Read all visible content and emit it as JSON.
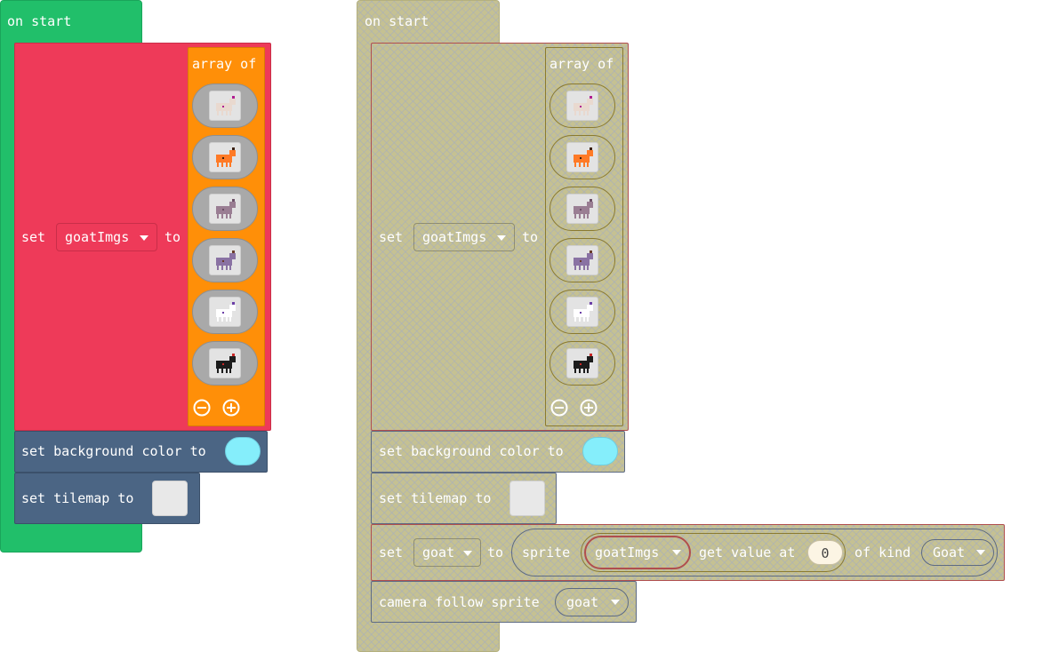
{
  "left_stack": {
    "hat_label": "on start",
    "set_keyword": "set",
    "variable": "goatImgs",
    "to_keyword": "to",
    "array_label": "array of",
    "images": [
      {
        "icon": "white-goat-icon"
      },
      {
        "icon": "orange-goat-icon"
      },
      {
        "icon": "grey-goat-icon"
      },
      {
        "icon": "purple-goat-icon"
      },
      {
        "icon": "white-horned-goat-icon"
      },
      {
        "icon": "black-goat-icon"
      }
    ],
    "background_label": "set background color to",
    "background_color": "#85eefb",
    "tilemap_label": "set tilemap to"
  },
  "right_stack": {
    "hat_label": "on start",
    "set_keyword": "set",
    "variable": "goatImgs",
    "to_keyword": "to",
    "array_label": "array of",
    "background_label": "set background color to",
    "tilemap_label": "set tilemap to",
    "sprite_set_keyword": "set",
    "sprite_variable": "goat",
    "sprite_to_keyword": "to",
    "sprite_keyword": "sprite",
    "array_var": "goatImgs",
    "get_value_label": "get value at",
    "index_value": "0",
    "of_kind_label": "of kind",
    "kind_value": "Goat",
    "camera_label": "camera follow sprite",
    "camera_target": "goat"
  },
  "colors": {
    "loops_green": "#21bf6a",
    "variables_red": "#ee3a59",
    "arrays_orange": "#ff8f08",
    "scene_blue": "#4b6584"
  }
}
